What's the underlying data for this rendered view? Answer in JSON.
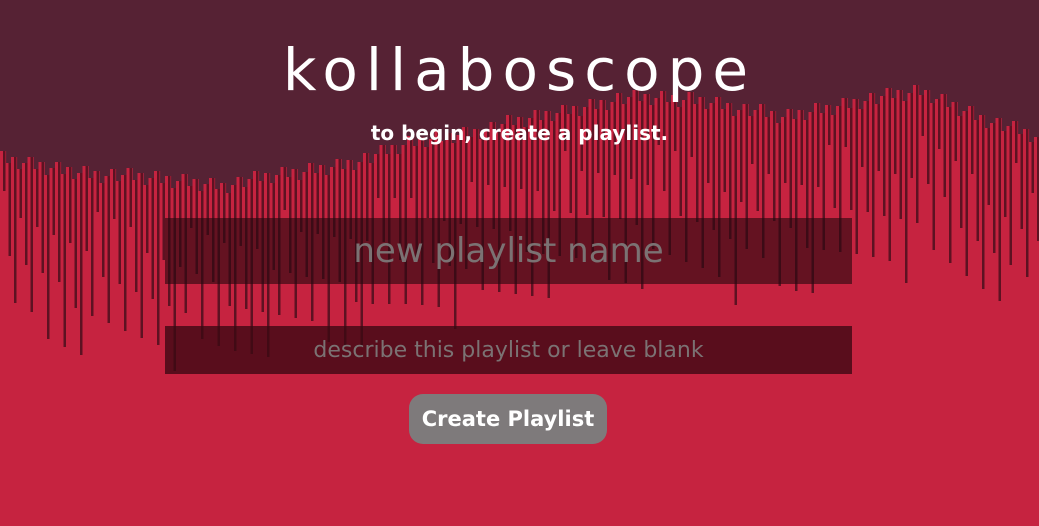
{
  "app": {
    "title": "kollaboscope",
    "subtitle": "to begin, create a playlist."
  },
  "form": {
    "name_placeholder": "new playlist name",
    "description_placeholder": "describe this playlist or leave blank",
    "submit_label": "Create Playlist"
  },
  "colors": {
    "background": "#c62340",
    "top_band": "#562234",
    "bar_shadow": "#3a0d18",
    "button": "#7e7a7b",
    "text": "#ffffff"
  }
}
